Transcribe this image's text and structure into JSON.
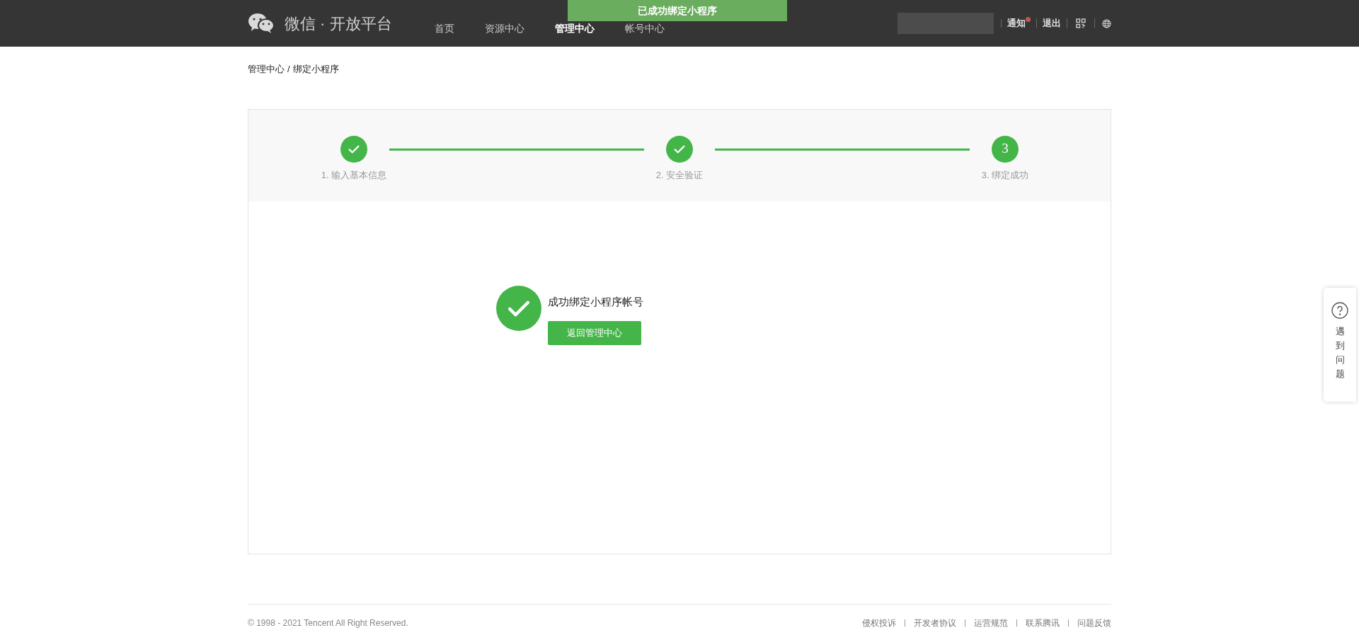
{
  "header": {
    "brand": "微信 · 开放平台",
    "nav": [
      {
        "label": "首页",
        "selected": false
      },
      {
        "label": "资源中心",
        "selected": false
      },
      {
        "label": "管理中心",
        "selected": true
      },
      {
        "label": "帐号中心",
        "selected": false
      }
    ],
    "notice": {
      "label": "通知",
      "unread": true
    },
    "logout": "退出"
  },
  "toast": "已成功绑定小程序",
  "breadcrumb": [
    "管理中心",
    "/",
    "绑定小程序"
  ],
  "steps": [
    {
      "label": "1. 输入基本信息",
      "done": true
    },
    {
      "label": "2. 安全验证",
      "done": true
    },
    {
      "number": "3",
      "label": "3. 绑定成功",
      "done": false
    }
  ],
  "result": {
    "message": "成功绑定小程序帐号",
    "button": "返回管理中心"
  },
  "footer": {
    "copyright": "© 1998 - 2021 Tencent All Right Reserved.",
    "links": [
      "侵权投诉",
      "开发者协议",
      "运营规范",
      "联系腾讯",
      "问题反馈"
    ]
  },
  "help": "遇到问题"
}
